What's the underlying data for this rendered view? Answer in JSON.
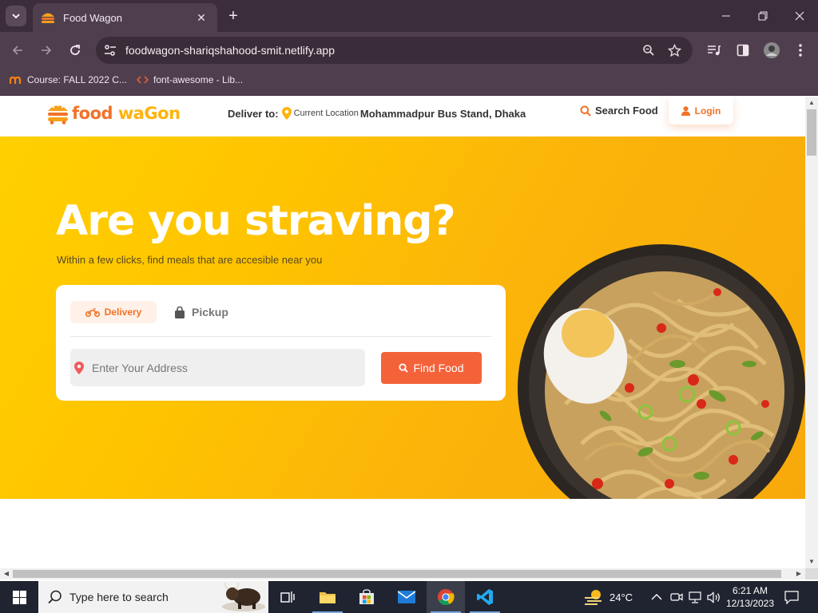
{
  "browser": {
    "tab_title": "Food Wagon",
    "url": "foodwagon-shariqshahood-smit.netlify.app",
    "bookmarks": [
      {
        "label": "Course: FALL 2022 C...",
        "icon": "moodle-icon"
      },
      {
        "label": "font-awesome - Lib...",
        "icon": "code-icon"
      }
    ]
  },
  "header": {
    "logo_word1": "food",
    "logo_word2": "waGon",
    "deliver_label": "Deliver to:",
    "current_location": "Current Location",
    "address": "Mohammadpur Bus Stand, Dhaka",
    "search_label": "Search Food",
    "login_label": "Login"
  },
  "hero": {
    "title": "Are you straving?",
    "subtitle": "Within a few clicks, find meals that are accesible near you",
    "tab_delivery": "Delivery",
    "tab_pickup": "Pickup",
    "address_placeholder": "Enter Your Address",
    "find_button": "Find Food"
  },
  "taskbar": {
    "search_placeholder": "Type here to search",
    "temperature": "24°C",
    "time": "6:21 AM",
    "date": "12/13/2023"
  },
  "colors": {
    "brand_orange": "#f17228",
    "brand_yellow": "#ffb30e",
    "button_red": "#f4623a"
  }
}
